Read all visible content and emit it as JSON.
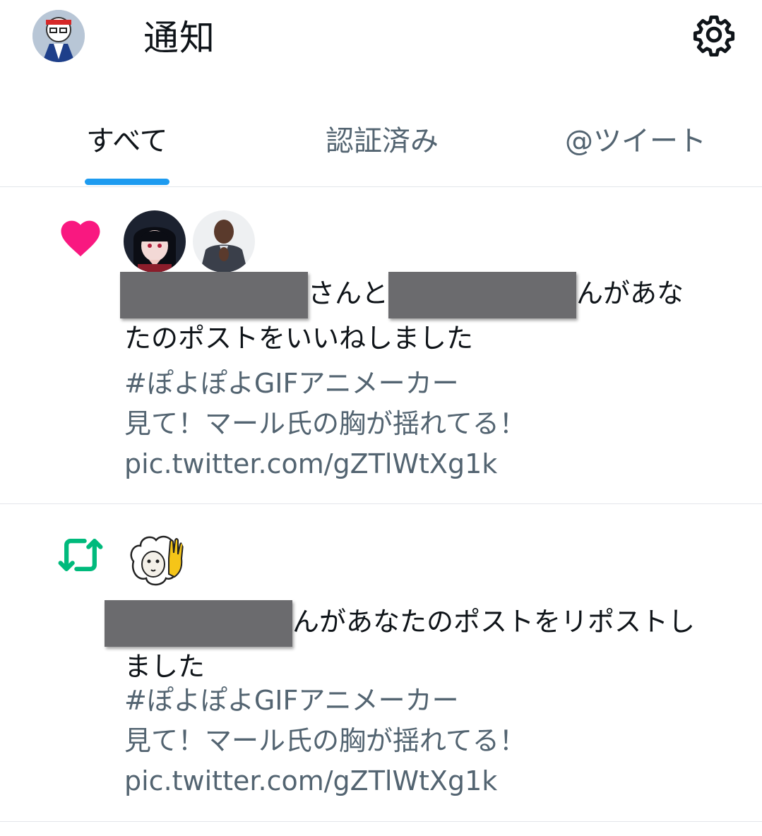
{
  "header": {
    "title": "通知",
    "settings_icon": "gear-icon"
  },
  "tabs": [
    {
      "label": "すべて",
      "active": true
    },
    {
      "label": "認証済み",
      "active": false
    },
    {
      "label": "@ツイート",
      "active": false
    }
  ],
  "notifications": [
    {
      "type": "like",
      "icon": "heart-icon",
      "icon_color": "#f91880",
      "text_part1": "さんと",
      "text_part2": "んがあな",
      "text_line2": "たのポストをいいねしました",
      "preview": [
        "#ぽよぽよGIFアニメーカー",
        "見て！マール氏の胸が揺れてる！",
        "pic.twitter.com/gZTlWtXg1k"
      ]
    },
    {
      "type": "repost",
      "icon": "repost-icon",
      "icon_color": "#00ba7c",
      "text_part1": "んがあなたのポストをリポストし",
      "text_line2": "ました",
      "preview": [
        "#ぽよぽよGIFアニメーカー",
        "見て！マール氏の胸が揺れてる！",
        "pic.twitter.com/gZTlWtXg1k"
      ]
    }
  ],
  "colors": {
    "accent": "#1d9bf0",
    "text": "#0f1419",
    "secondary": "#536471",
    "like": "#f91880",
    "repost": "#00ba7c"
  }
}
